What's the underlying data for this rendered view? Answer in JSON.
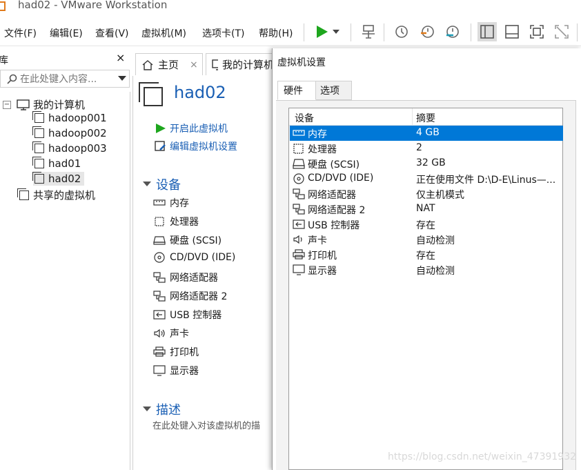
{
  "window": {
    "title": "had02 - VMware Workstation"
  },
  "menu": [
    "文件(F)",
    "编辑(E)",
    "查看(V)",
    "虚拟机(M)",
    "选项卡(T)",
    "帮助(H)"
  ],
  "library": {
    "title": "库",
    "close": "×",
    "search_placeholder": "在此处键入内容...",
    "root": "我的计算机",
    "vms": [
      "hadoop001",
      "hadoop002",
      "hadoop003",
      "had01",
      "had02"
    ],
    "shared": "共享的虚拟机"
  },
  "tabs": [
    {
      "label": "主页"
    },
    {
      "label": "我的计算机"
    }
  ],
  "vm_page": {
    "name": "had02",
    "actions": [
      "开启此虚拟机",
      "编辑虚拟机设置"
    ],
    "devices_title": "设备",
    "devices": [
      "内存",
      "处理器",
      "硬盘 (SCSI)",
      "CD/DVD (IDE)",
      "网络适配器",
      "网络适配器 2",
      "USB 控制器",
      "声卡",
      "打印机",
      "显示器"
    ],
    "description_title": "描述",
    "description_placeholder": "在此处键入对该虚拟机的描"
  },
  "dialog": {
    "title": "虚拟机设置",
    "tabs": [
      "硬件",
      "选项"
    ],
    "columns": [
      "设备",
      "摘要"
    ],
    "rows": [
      {
        "device": "内存",
        "summary": "4 GB",
        "icon": "memory-icon"
      },
      {
        "device": "处理器",
        "summary": "2",
        "icon": "processor-icon"
      },
      {
        "device": "硬盘 (SCSI)",
        "summary": "32 GB",
        "icon": "hard-disk-icon"
      },
      {
        "device": "CD/DVD (IDE)",
        "summary": "正在使用文件 D:\\D-E\\Linus—...",
        "icon": "cd-dvd-icon"
      },
      {
        "device": "网络适配器",
        "summary": "仅主机模式",
        "icon": "network-adapter-icon"
      },
      {
        "device": "网络适配器 2",
        "summary": "NAT",
        "icon": "network-adapter-icon"
      },
      {
        "device": "USB 控制器",
        "summary": "存在",
        "icon": "usb-icon"
      },
      {
        "device": "声卡",
        "summary": "自动检测",
        "icon": "sound-icon"
      },
      {
        "device": "打印机",
        "summary": "存在",
        "icon": "printer-icon"
      },
      {
        "device": "显示器",
        "summary": "自动检测",
        "icon": "display-icon"
      }
    ],
    "selected_row": 0
  },
  "watermark": "https://blog.csdn.net/weixin_47391932",
  "colors": {
    "accent": "#0078d7",
    "link": "#1a5fb4",
    "play": "#1ea61e"
  }
}
